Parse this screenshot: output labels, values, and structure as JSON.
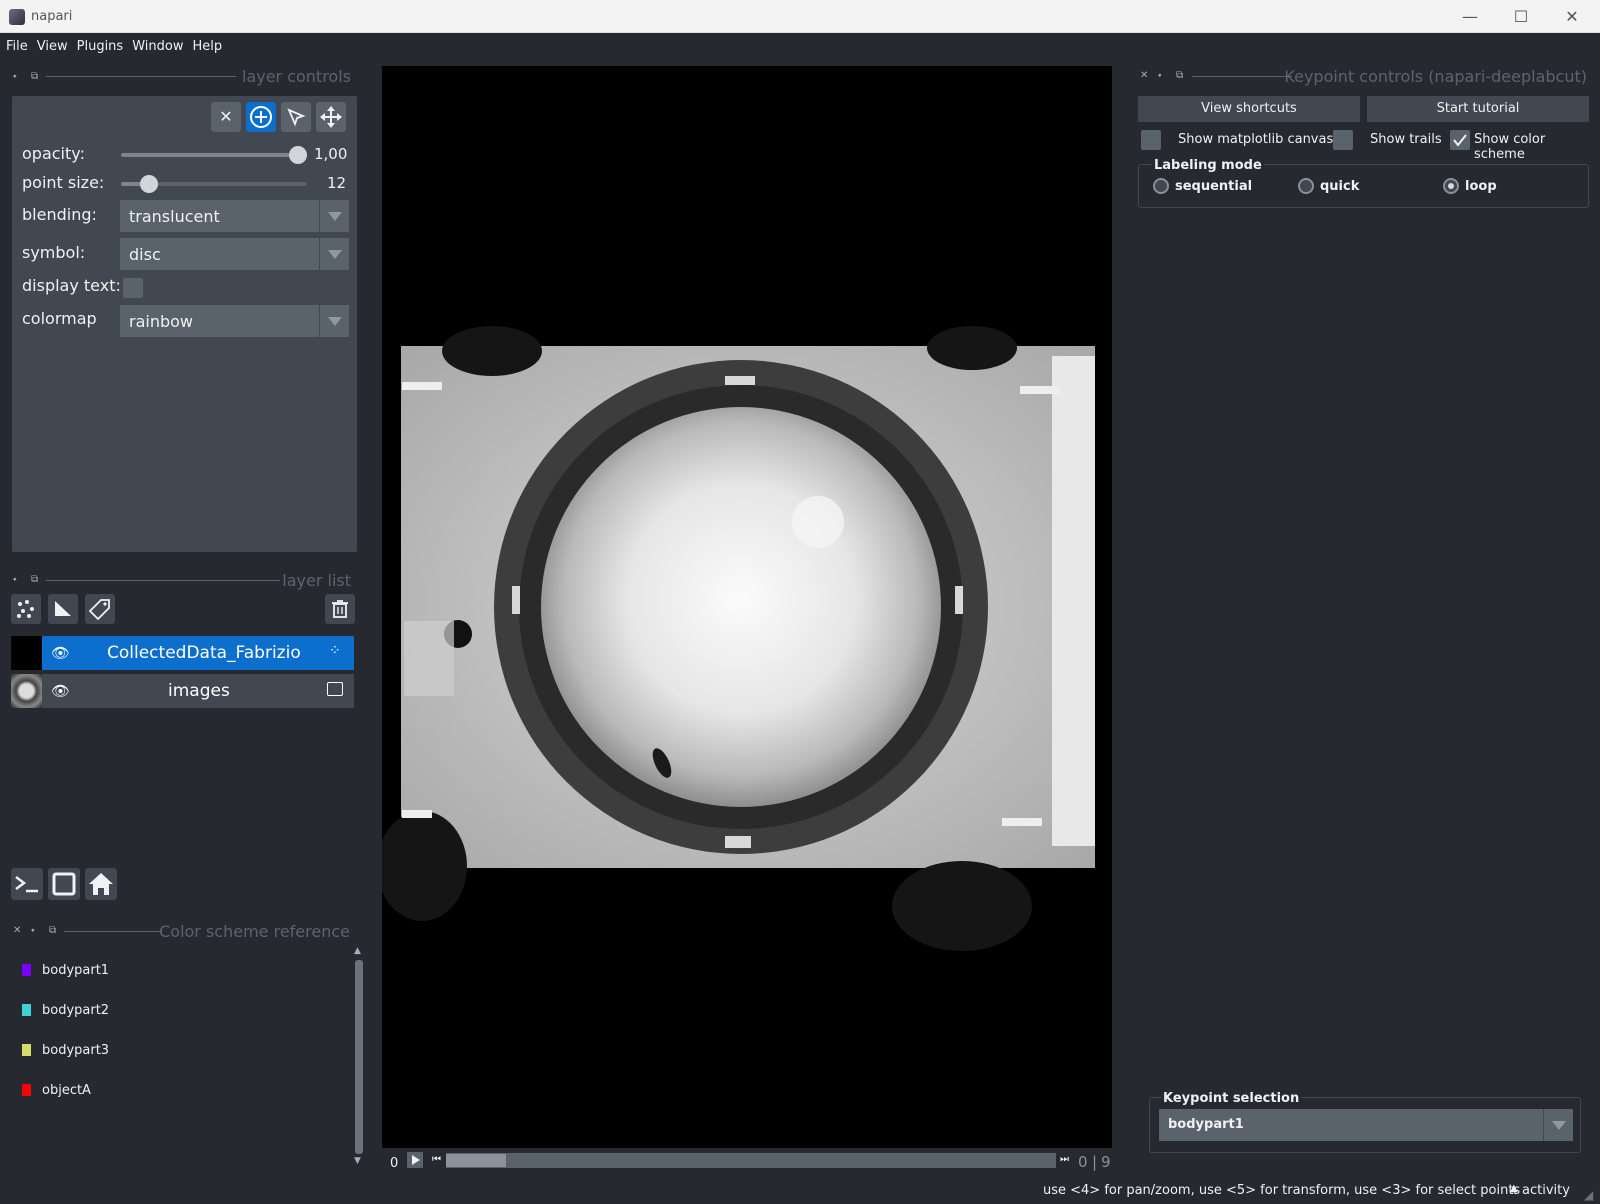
{
  "window": {
    "title": "napari"
  },
  "menu": [
    "File",
    "View",
    "Plugins",
    "Window",
    "Help"
  ],
  "layer_controls": {
    "title": "layer controls",
    "opacity_label": "opacity:",
    "opacity_value": "1,00",
    "opacity_level": 1.0,
    "point_size_label": "point size:",
    "point_size_value": "12",
    "point_size_level": 0.12,
    "blending_label": "blending:",
    "blending_value": "translucent",
    "symbol_label": "symbol:",
    "symbol_value": "disc",
    "display_text_label": "display text:",
    "colormap_label": "colormap",
    "colormap_value": "rainbow"
  },
  "layer_list": {
    "title": "layer list",
    "layers": [
      {
        "name": "CollectedData_Fabrizio",
        "selected": true
      },
      {
        "name": "images",
        "selected": false
      }
    ]
  },
  "color_scheme": {
    "title": "Color scheme reference",
    "items": [
      {
        "label": "bodypart1",
        "color": "#7b00ff"
      },
      {
        "label": "bodypart2",
        "color": "#3fd1d6"
      },
      {
        "label": "bodypart3",
        "color": "#d6dc6b"
      },
      {
        "label": "objectA",
        "color": "#ff0000"
      }
    ]
  },
  "dims": {
    "current": "0",
    "slider_value": "0",
    "slider_max": "9"
  },
  "keypoint_controls": {
    "title": "Keypoint controls (napari-deeplabcut)",
    "view_shortcuts": "View shortcuts",
    "start_tutorial": "Start tutorial",
    "show_matplotlib": "Show matplotlib canvas",
    "show_trails": "Show trails",
    "show_color_scheme": "Show color scheme",
    "labeling_mode_title": "Labeling mode",
    "modes": [
      "sequential",
      "quick",
      "loop"
    ],
    "selected_mode": "loop",
    "keypoint_selection_title": "Keypoint selection",
    "keypoint_selection_value": "bodypart1"
  },
  "status": {
    "hint": "use <4> for pan/zoom, use <5> for transform, use <3> for select points",
    "activity": "activity"
  },
  "colors": {
    "accent": "#0d6fcd",
    "background": "#262930",
    "panel": "#414851"
  }
}
